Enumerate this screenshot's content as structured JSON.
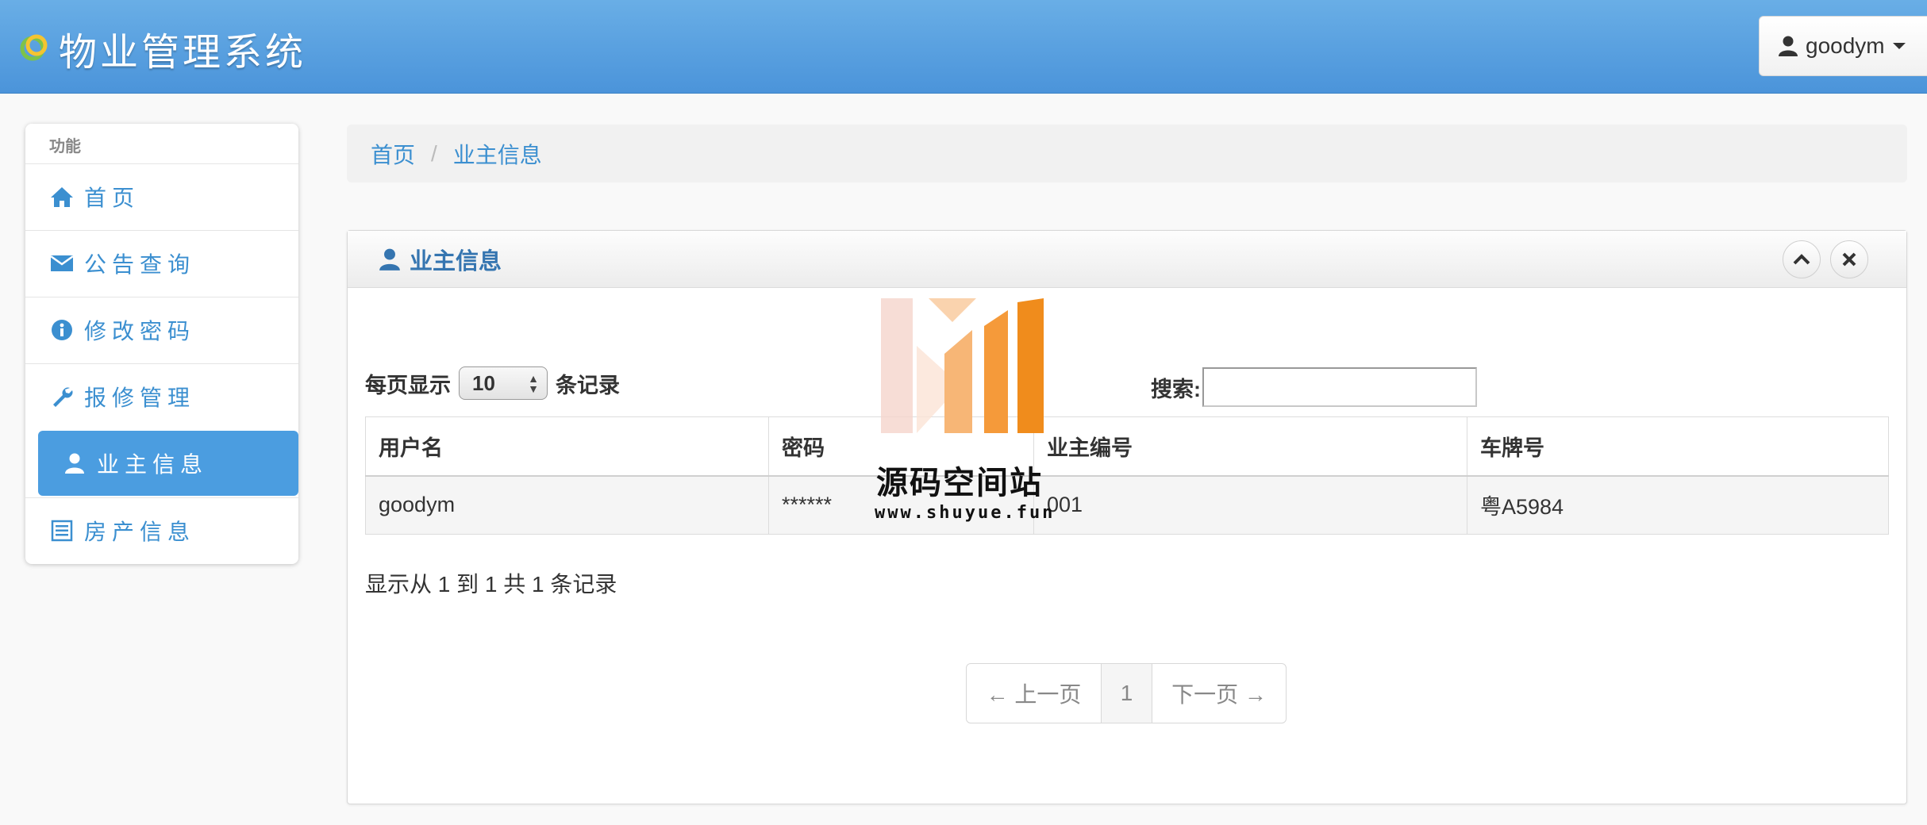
{
  "app": {
    "title": "物业管理系统"
  },
  "user": {
    "name": "goodym"
  },
  "sidebar": {
    "header": "功能",
    "items": [
      {
        "label": "首页",
        "icon": "home-icon"
      },
      {
        "label": "公告查询",
        "icon": "envelope-icon"
      },
      {
        "label": "修改密码",
        "icon": "info-icon"
      },
      {
        "label": "报修管理",
        "icon": "wrench-icon"
      },
      {
        "label": "业主信息",
        "icon": "user-icon",
        "active": true
      },
      {
        "label": "房产信息",
        "icon": "list-icon"
      }
    ]
  },
  "breadcrumb": {
    "home": "首页",
    "separator": "/",
    "current": "业主信息"
  },
  "panel": {
    "title": "业主信息",
    "length": {
      "prefix": "每页显示",
      "value": "10",
      "suffix": "条记录"
    },
    "search": {
      "label": "搜索:",
      "value": ""
    },
    "table": {
      "columns": [
        "用户名",
        "密码",
        "业主编号",
        "车牌号"
      ],
      "rows": [
        [
          "goodym",
          "******",
          "001",
          "粤A5984"
        ]
      ]
    },
    "info": "显示从 1 到 1 共 1 条记录",
    "pager": {
      "prev": "← 上一页",
      "page": "1",
      "next": "下一页 →"
    }
  },
  "watermark": {
    "title": "源码空间站",
    "url": "www.shuyue.fun"
  },
  "colors": {
    "navbar": "#4b94da",
    "accent": "#3b8fd0",
    "active": "#4b9de0"
  }
}
